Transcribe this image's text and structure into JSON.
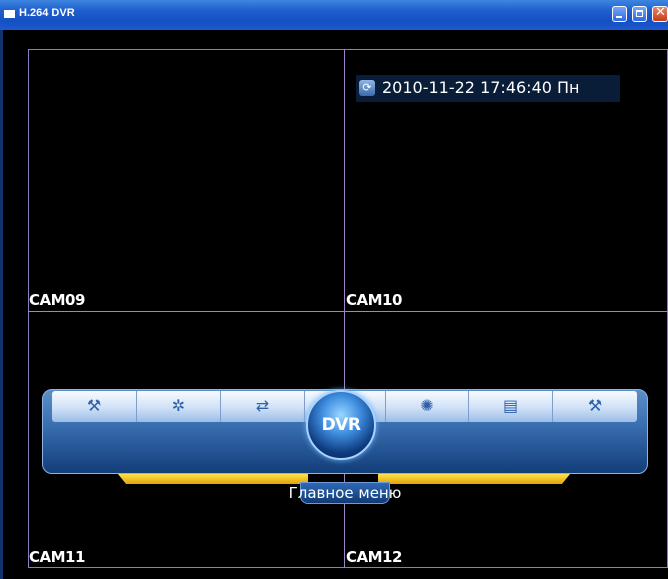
{
  "window": {
    "title": "H.264 DVR",
    "controls": {
      "minimize": "minimize-icon",
      "maximize": "maximize-icon",
      "close": "close-icon"
    }
  },
  "cameras": [
    {
      "label": "CAM09"
    },
    {
      "label": "CAM10"
    },
    {
      "label": "CAM11"
    },
    {
      "label": "CAM12"
    }
  ],
  "timestamp": {
    "text": "2010-11-22 17:46:40 Пн",
    "icon": "refresh-icon"
  },
  "main_menu": {
    "center_button": "DVR",
    "label": "Главное меню",
    "items": [
      {
        "icon": "tools-icon"
      },
      {
        "icon": "gear-icon"
      },
      {
        "icon": "arrows-icon"
      },
      {
        "icon": "lightbulb-icon"
      },
      {
        "icon": "document-settings-icon"
      },
      {
        "icon": "tools-icon"
      }
    ]
  },
  "colors": {
    "titlebar": "#1f5fcd",
    "grid_line": "#9d86c7",
    "menu_blue": "#3b70b2",
    "menu_gold": "#ffd43a"
  }
}
